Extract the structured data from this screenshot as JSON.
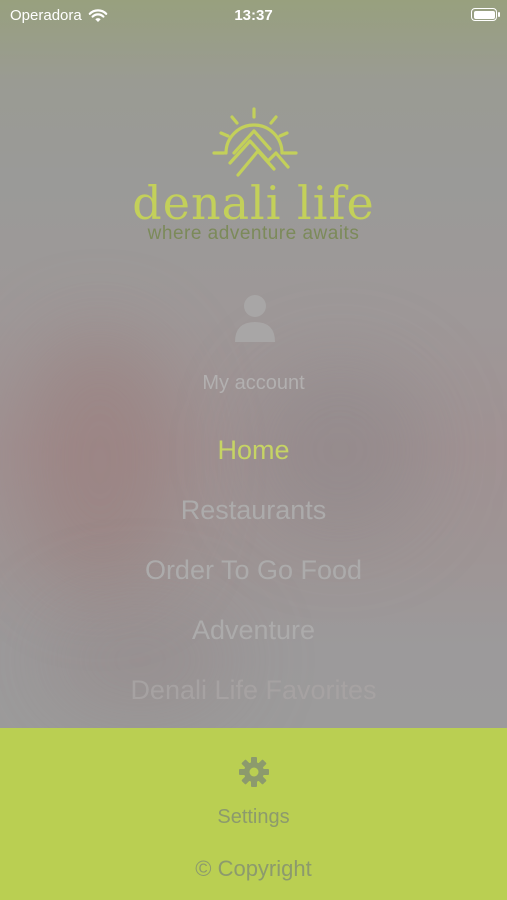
{
  "status_bar": {
    "carrier": "Operadora",
    "time": "13:37"
  },
  "brand": {
    "name": "denali life",
    "tagline": "where adventure awaits",
    "logo_icon": "sun-mountain-icon",
    "accent_color": "#c3d05a"
  },
  "account": {
    "icon": "user-icon",
    "label": "My account"
  },
  "menu": {
    "items": [
      {
        "label": "Home",
        "active": true
      },
      {
        "label": "Restaurants"
      },
      {
        "label": "Order To Go Food"
      },
      {
        "label": "Adventure"
      },
      {
        "label": "Denali Life Favorites"
      }
    ]
  },
  "footer": {
    "background": "#bacf52",
    "settings_icon": "gear-icon",
    "settings_label": "Settings",
    "copyright_label": "© Copyright"
  }
}
